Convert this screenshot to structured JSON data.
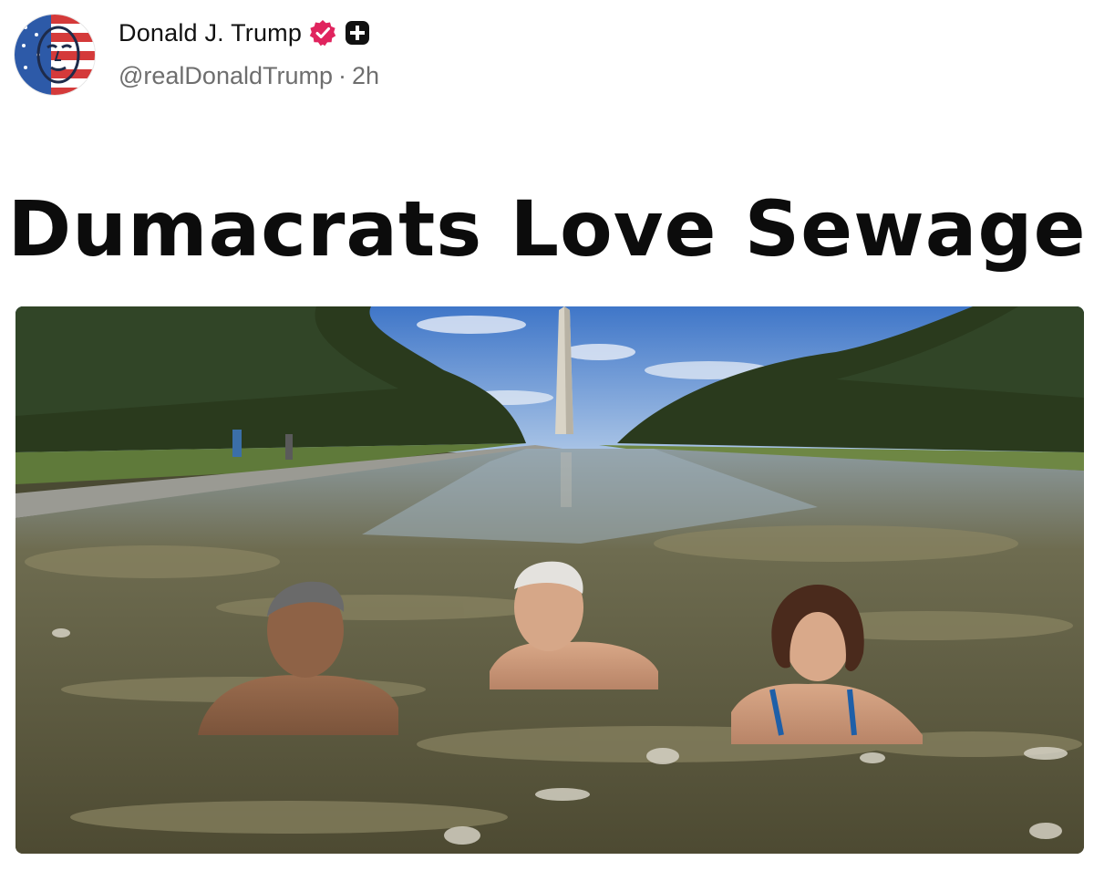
{
  "post": {
    "author": {
      "display_name": "Donald J. Trump",
      "handle": "@realDonaldTrump",
      "time_ago": "2h",
      "separator": "·",
      "verified_badge_color": "#e0245e",
      "avatar_icon": "profile-avatar",
      "badge_icons": [
        "verified-badge-icon",
        "plus-badge-icon"
      ]
    },
    "headline": "Dumacrats Love Sewage",
    "image": {
      "icon": "photo-image",
      "colors": {
        "sky": "#5b8fd8",
        "trees": "#2b3d1f",
        "water": "#6b6a4e",
        "monument": "#d9d4c7"
      }
    }
  }
}
